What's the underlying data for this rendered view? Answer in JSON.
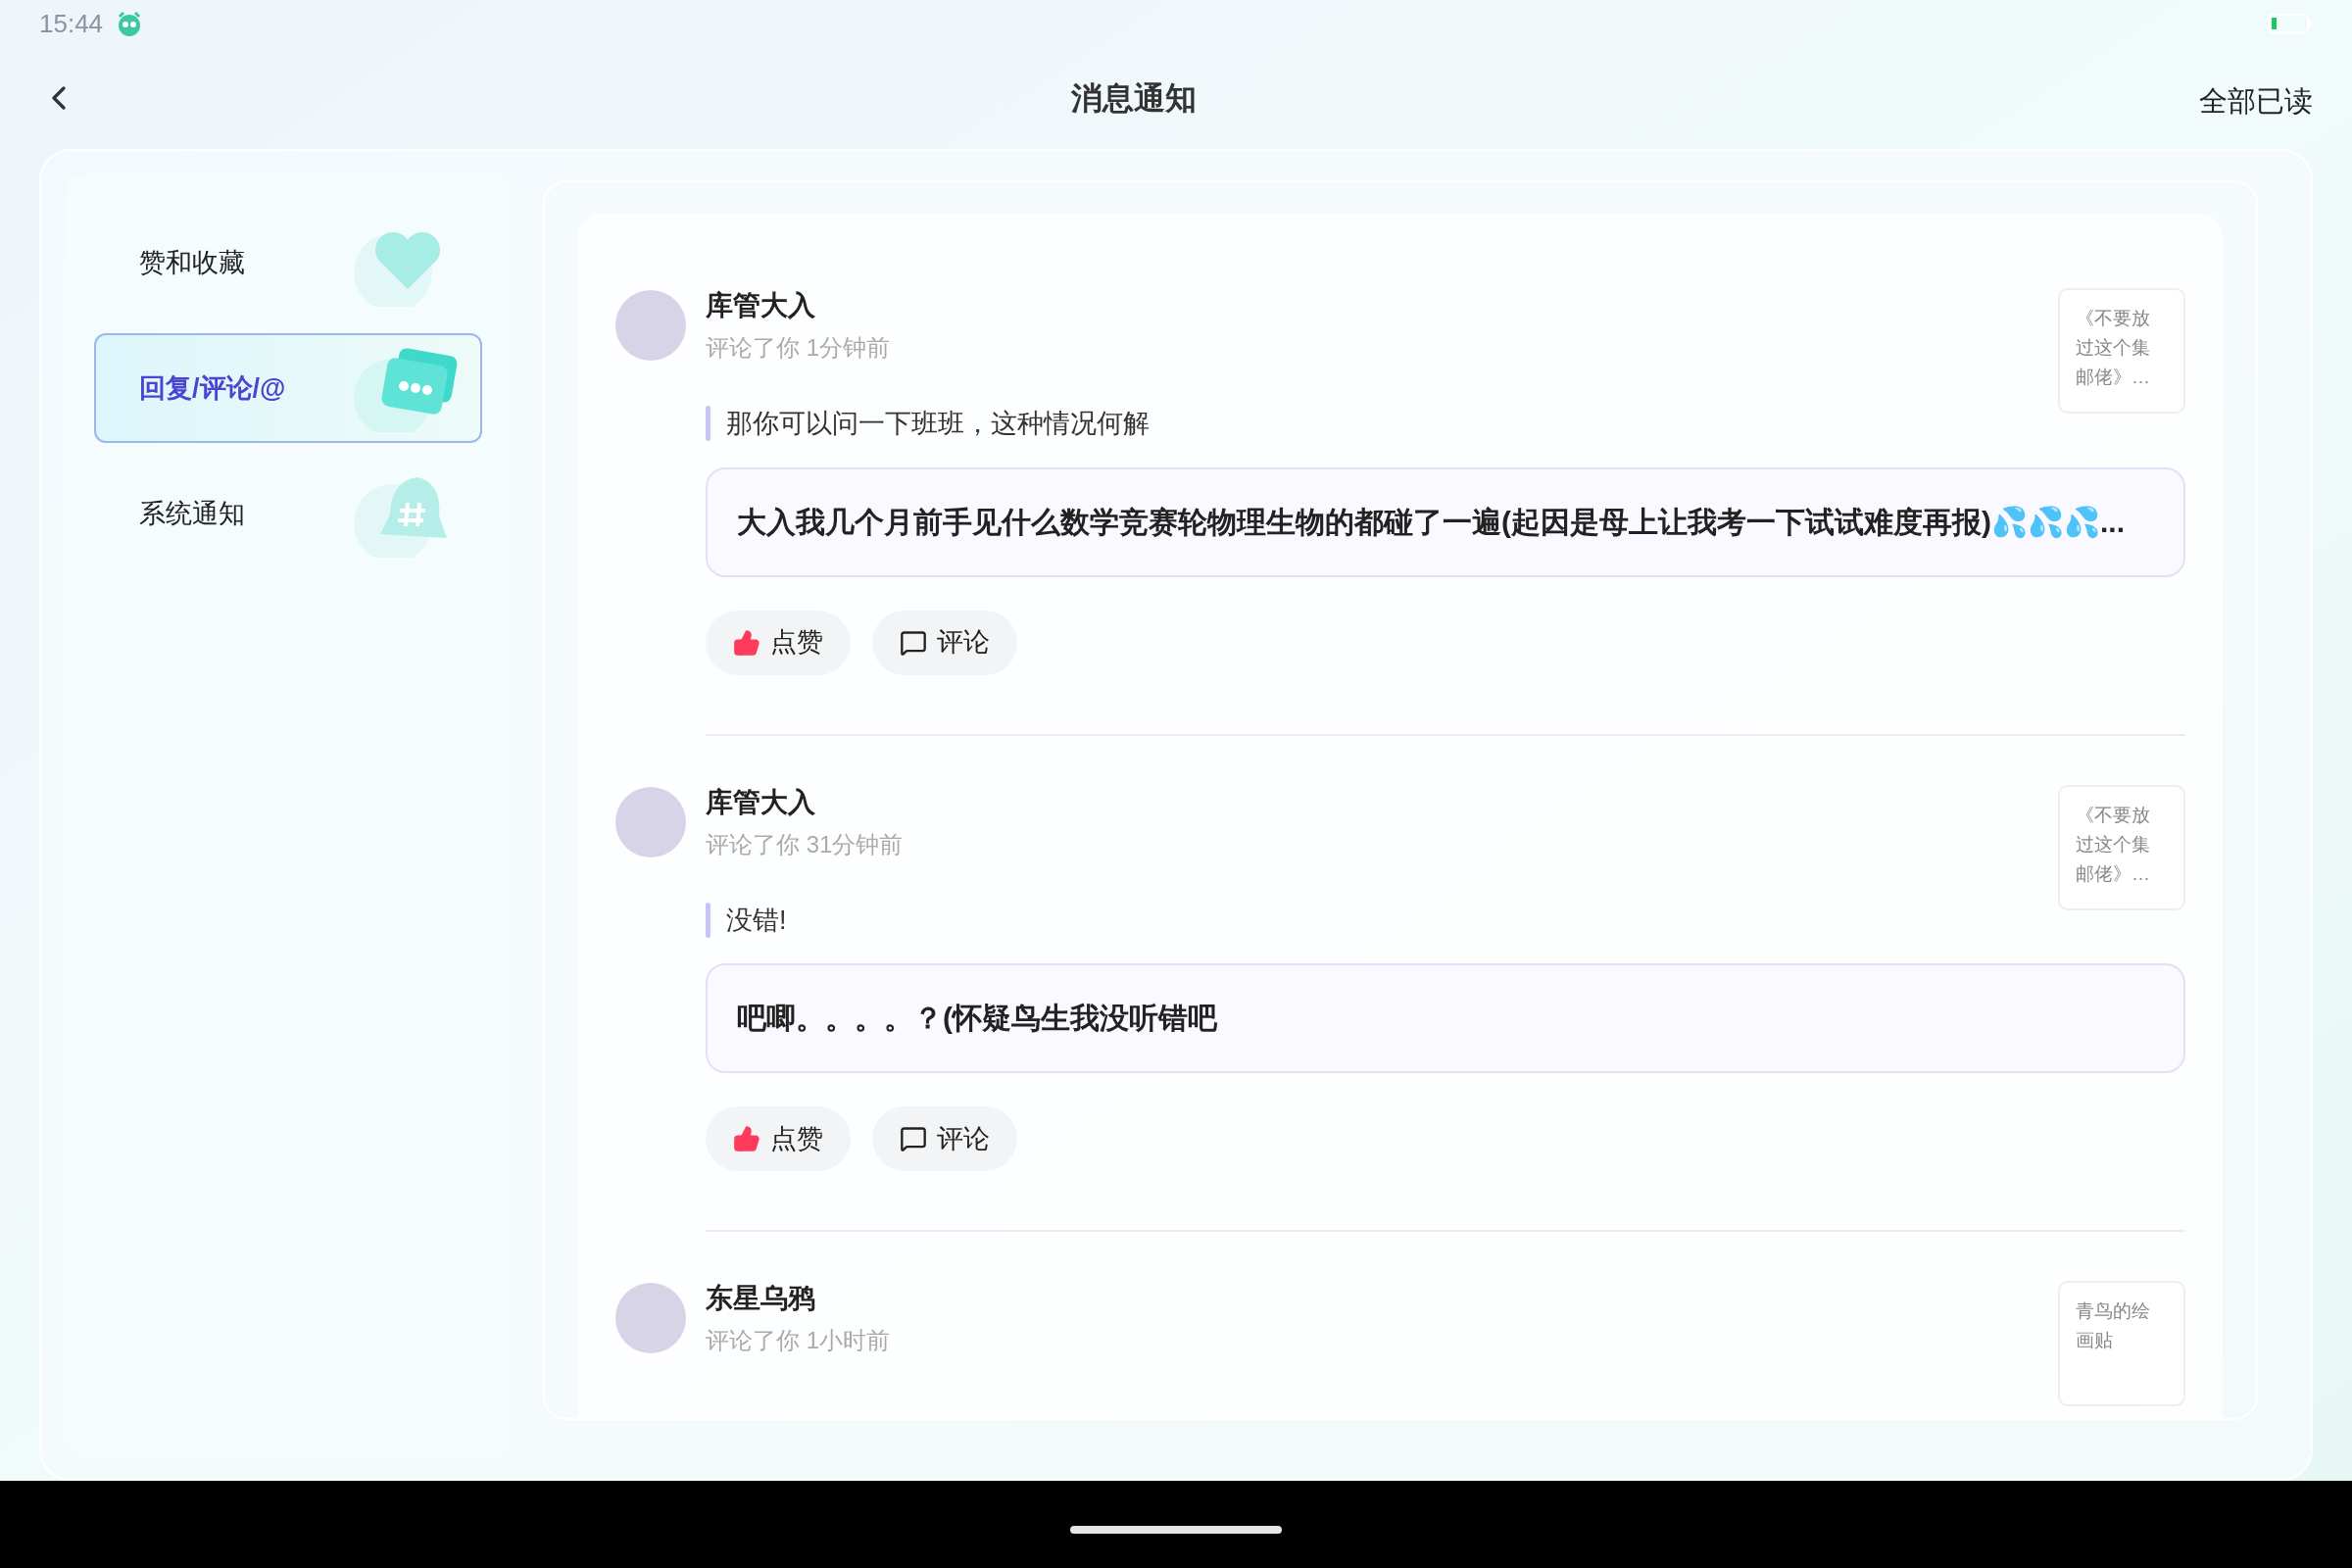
{
  "status_bar": {
    "time": "15:44"
  },
  "header": {
    "title": "消息通知",
    "action": "全部已读"
  },
  "sidebar": {
    "items": [
      {
        "kind": "like",
        "label": "赞和收藏",
        "selected": false
      },
      {
        "kind": "reply",
        "label": "回复/评论/@",
        "selected": true
      },
      {
        "kind": "system",
        "label": "系统通知",
        "selected": false
      }
    ]
  },
  "notifications": [
    {
      "user": "库管大入",
      "meta": "评论了你 1分钟前",
      "quote": "那你可以问一下班班，这种情况何解",
      "reply": "大入我几个月前手见什么数学竞赛轮物理生物的都碰了一遍(起因是母上让我考一下试试难度再报)💦💦💦...",
      "post": "《不要放过这个集邮佬》…",
      "actions": [
        {
          "kind": "like",
          "label": "点赞"
        },
        {
          "kind": "comment",
          "label": "评论"
        }
      ]
    },
    {
      "user": "库管大入",
      "meta": "评论了你 31分钟前",
      "quote": "没错!",
      "reply": "吧唧。。。。？(怀疑鸟生我没听错吧",
      "post": "《不要放过这个集邮佬》…",
      "actions": [
        {
          "kind": "like",
          "label": "点赞"
        },
        {
          "kind": "comment",
          "label": "评论"
        }
      ]
    },
    {
      "user": "东星乌鸦",
      "meta": "评论了你 1小时前",
      "post": "青鸟的绘画贴"
    }
  ]
}
